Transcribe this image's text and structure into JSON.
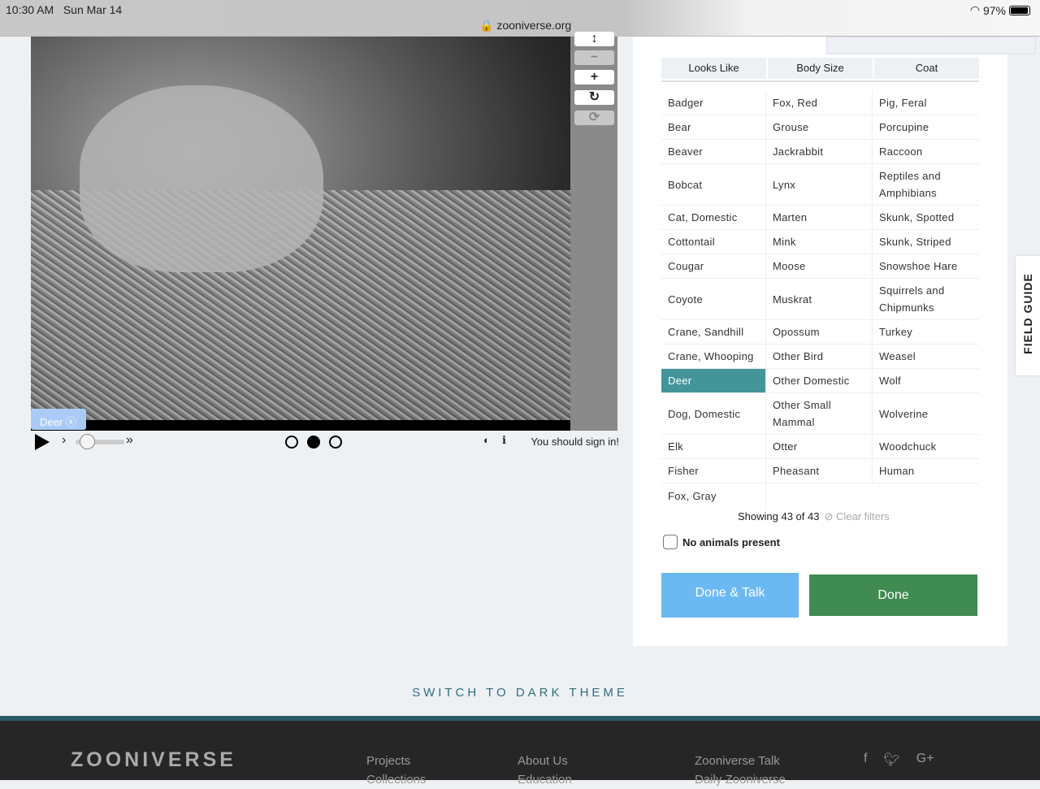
{
  "status": {
    "time": "10:30 AM",
    "date": "Sun Mar 14",
    "url": "zooniverse.org",
    "battery": "97%"
  },
  "viewer": {
    "tag": "Deer",
    "sign_in": "You should sign in!",
    "frames": 3,
    "current_frame": 2
  },
  "filters": [
    "Looks Like",
    "Body Size",
    "Coat"
  ],
  "rows": [
    [
      "Badger",
      "Fox, Red",
      "Pig, Feral"
    ],
    [
      "Bear",
      "Grouse",
      "Porcupine"
    ],
    [
      "Beaver",
      "Jackrabbit",
      "Raccoon"
    ],
    [
      "Bobcat",
      "Lynx",
      "Reptiles and Amphibians"
    ],
    [
      "Cat, Domestic",
      "Marten",
      "Skunk, Spotted"
    ],
    [
      "Cottontail",
      "Mink",
      "Skunk, Striped"
    ],
    [
      "Cougar",
      "Moose",
      "Snowshoe Hare"
    ],
    [
      "Coyote",
      "Muskrat",
      "Squirrels and Chipmunks"
    ],
    [
      "Crane, Sandhill",
      "Opossum",
      "Turkey"
    ],
    [
      "Crane, Whooping",
      "Other Bird",
      "Weasel"
    ],
    [
      "Deer",
      "Other Domestic",
      "Wolf"
    ],
    [
      "Dog, Domestic",
      "Other Small Mammal",
      "Wolverine"
    ],
    [
      "Elk",
      "Otter",
      "Woodchuck"
    ],
    [
      "Fisher",
      "Pheasant",
      "Human"
    ],
    [
      "Fox, Gray",
      "",
      ""
    ]
  ],
  "selected": "Deer",
  "showing": "Showing 43 of 43",
  "clear_filters": "Clear filters",
  "no_animals": "No animals present",
  "done_talk": "Done & Talk",
  "done": "Done",
  "field_guide": "FIELD GUIDE",
  "dark_theme": "SWITCH TO DARK THEME",
  "footer": {
    "logo": "ZOONIVERSE",
    "col1": [
      "Projects",
      "Collections"
    ],
    "col2": [
      "About Us",
      "Education"
    ],
    "col3": [
      "Zooniverse Talk",
      "Daily Zooniverse"
    ]
  }
}
